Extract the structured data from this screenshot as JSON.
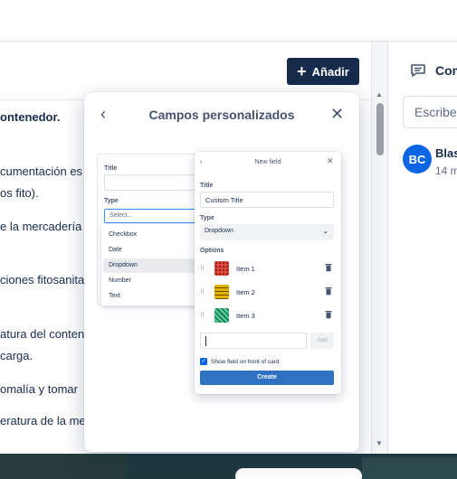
{
  "toolbar": {
    "add_label": "Añadir"
  },
  "document": {
    "lines": [
      "ontenedor.",
      "cumentación es",
      "os fito).",
      "e la mercadería",
      "ciones fitosanita",
      "atura del conten",
      " carga.",
      "omalía y tomar",
      "eratura de la me"
    ]
  },
  "comments": {
    "header": "Com",
    "input_placeholder": "Escribe",
    "entry": {
      "avatar_initials": "BC",
      "author": "Blas",
      "time": "14 m"
    }
  },
  "popover": {
    "title": "Campos personalizados",
    "illustration": {
      "back_card": {
        "title_label": "Title",
        "type_label": "Type",
        "select_placeholder": "Select...",
        "options": [
          "Checkbox",
          "Date",
          "Dropdown",
          "Number",
          "Text"
        ],
        "selected_option": "Dropdown"
      },
      "front_card": {
        "header": "New field",
        "title_label": "Title",
        "title_value": "Custom Title",
        "type_label": "Type",
        "type_value": "Dropdown",
        "options_label": "Options",
        "items": [
          {
            "label": "Item 1",
            "color": "#e2483d"
          },
          {
            "label": "Item 2",
            "color": "#e2b203"
          },
          {
            "label": "Item 3",
            "color": "#4bce97"
          }
        ],
        "add_button": "Add",
        "checkbox_label": "Show field on front of card",
        "create_button": "Create"
      }
    }
  },
  "colors": {
    "primary_button": "#172b4d",
    "accent_blue": "#0c66e4",
    "create_blue": "#2f72c2"
  }
}
